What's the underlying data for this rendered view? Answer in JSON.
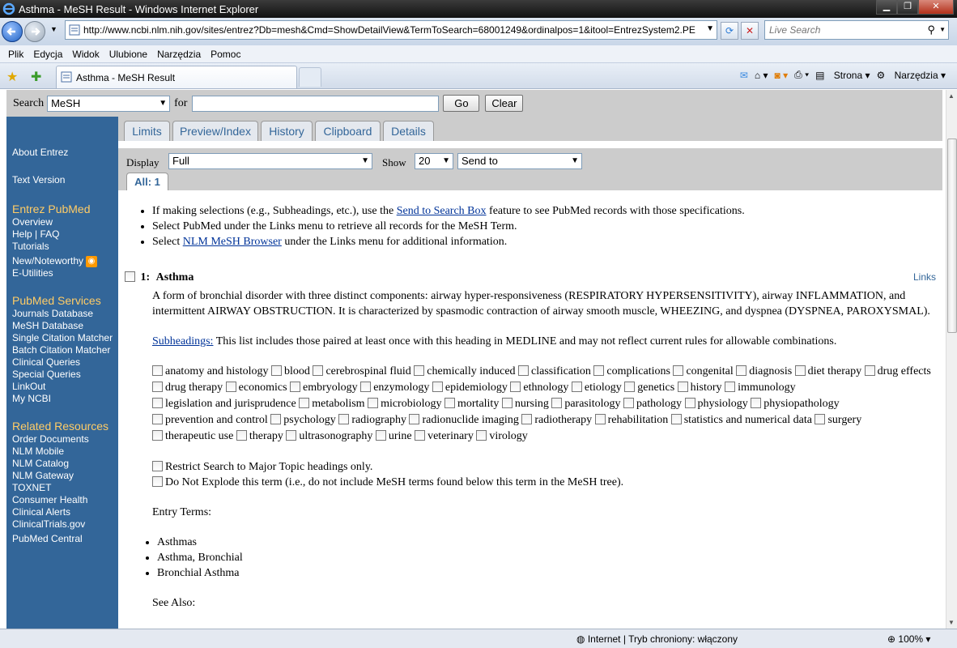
{
  "window": {
    "title": "Asthma - MeSH Result - Windows Internet Explorer"
  },
  "address": {
    "url": "http://www.ncbi.nlm.nih.gov/sites/entrez?Db=mesh&Cmd=ShowDetailView&TermToSearch=68001249&ordinalpos=1&itool=EntrezSystem2.PE",
    "live_search_placeholder": "Live Search"
  },
  "menu": [
    "Plik",
    "Edycja",
    "Widok",
    "Ulubione",
    "Narzędzia",
    "Pomoc"
  ],
  "tab": {
    "title": "Asthma - MeSH Result"
  },
  "toolbar": {
    "page": "Strona",
    "tools": "Narzędzia"
  },
  "search": {
    "label": "Search",
    "db": "MeSH",
    "for_label": "for",
    "query": "",
    "go": "Go",
    "clear": "Clear"
  },
  "page_tabs": [
    "Limits",
    "Preview/Index",
    "History",
    "Clipboard",
    "Details"
  ],
  "display": {
    "display_label": "Display",
    "display_value": "Full",
    "show_label": "Show",
    "show_value": "20",
    "send_to": "Send to",
    "all_tab": "All: 1"
  },
  "sidebar": {
    "top": [
      "About Entrez",
      "Text Version"
    ],
    "sections": [
      {
        "title": "Entrez PubMed",
        "items": [
          "Overview",
          "Help | FAQ",
          "Tutorials",
          "New/Noteworthy",
          "E-Utilities"
        ]
      },
      {
        "title": "PubMed Services",
        "items": [
          "Journals Database",
          "MeSH Database",
          "Single Citation Matcher",
          "Batch Citation Matcher",
          "Clinical Queries",
          "Special Queries",
          "LinkOut",
          "My NCBI"
        ]
      },
      {
        "title": "Related Resources",
        "items": [
          "Order Documents",
          "NLM Mobile",
          "NLM Catalog",
          "NLM Gateway",
          "TOXNET",
          "Consumer Health",
          "Clinical Alerts",
          "ClinicalTrials.gov",
          "PubMed Central"
        ]
      }
    ]
  },
  "tips": {
    "t1_pre": "If making selections (e.g., Subheadings, etc.), use the ",
    "t1_link": "Send to Search Box",
    "t1_post": " feature to see PubMed records with those specifications.",
    "t2": "Select PubMed under the Links menu to retrieve all records for the MeSH Term.",
    "t3_pre": "Select ",
    "t3_link": "NLM MeSH Browser",
    "t3_post": " under the Links menu for additional information."
  },
  "record": {
    "number": "1:",
    "term": "Asthma",
    "links": "Links",
    "definition": "A form of bronchial disorder with three distinct components: airway hyper-responsiveness (RESPIRATORY HYPERSENSITIVITY), airway INFLAMMATION, and intermittent AIRWAY OBSTRUCTION. It is characterized by spasmodic contraction of airway smooth muscle, WHEEZING, and dyspnea (DYSPNEA, PAROXYSMAL).",
    "subheadings_link": "Subheadings:",
    "subheadings_text": " This list includes those paired at least once with this heading in MEDLINE and may not reflect current rules for allowable combinations.",
    "subheadings": [
      "anatomy and histology",
      "blood",
      "cerebrospinal fluid",
      "chemically induced",
      "classification",
      "complications",
      "congenital",
      "diagnosis",
      "diet therapy",
      "drug effects",
      "drug therapy",
      "economics",
      "embryology",
      "enzymology",
      "epidemiology",
      "ethnology",
      "etiology",
      "genetics",
      "history",
      "immunology",
      "legislation and jurisprudence",
      "metabolism",
      "microbiology",
      "mortality",
      "nursing",
      "parasitology",
      "pathology",
      "physiology",
      "physiopathology",
      "prevention and control",
      "psychology",
      "radiography",
      "radionuclide imaging",
      "radiotherapy",
      "rehabilitation",
      "statistics and numerical data",
      "surgery",
      "therapeutic use",
      "therapy",
      "ultrasonography",
      "urine",
      "veterinary",
      "virology"
    ],
    "restrict": "Restrict Search to Major Topic headings only.",
    "noexplode": "Do Not Explode this term (i.e., do not include MeSH terms found below this term in the MeSH tree).",
    "entry_label": "Entry Terms:",
    "entry_terms": [
      "Asthmas",
      "Asthma, Bronchial",
      "Bronchial Asthma"
    ],
    "see_also": "See Also:"
  },
  "status": {
    "zone": "Internet | Tryb chroniony: włączony",
    "zoom": "100%"
  }
}
